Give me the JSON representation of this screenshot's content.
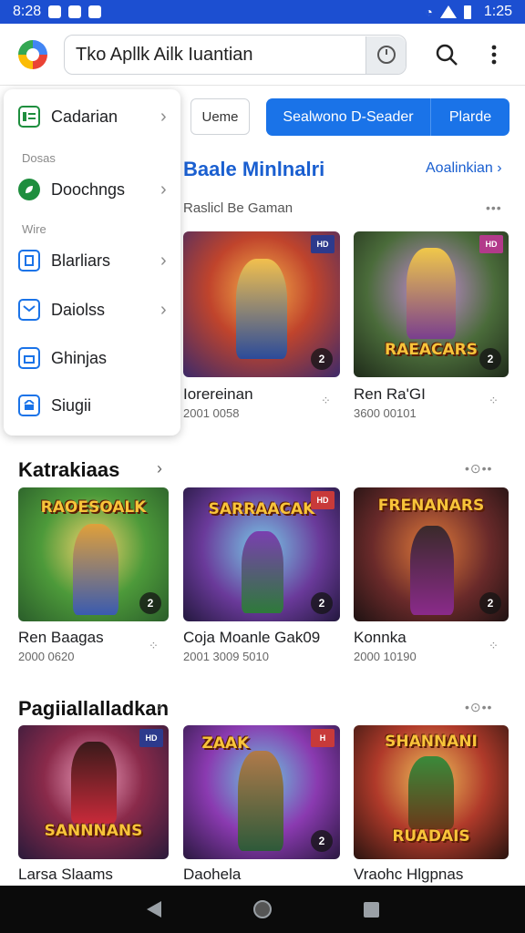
{
  "status_bar": {
    "time": "8:28",
    "clock": "1:25"
  },
  "search": {
    "query": "Tko Apllk Ailk Iuantian"
  },
  "dropdown": {
    "items": [
      {
        "label": "Cadarian",
        "icon": "list-icon",
        "color": "#1e8e3e"
      },
      {
        "label": "Doochngs",
        "icon": "leaf-icon",
        "color": "#1e8e3e"
      },
      {
        "label": "Blarliars",
        "icon": "phone-icon",
        "color": "#1a73e8"
      },
      {
        "label": "Daiolss",
        "icon": "mail-icon",
        "color": "#1a73e8"
      },
      {
        "label": "Ghinjas",
        "icon": "bag-icon",
        "color": "#1a73e8"
      },
      {
        "label": "Siugii",
        "icon": "store-icon",
        "color": "#1a73e8"
      }
    ],
    "headings": [
      "Dosas",
      "Wire"
    ]
  },
  "chips": {
    "home": "Ueme",
    "primary": "Sealwono D-Seader",
    "secondary": "Plarde"
  },
  "section1": {
    "title": "Baale Minlnalri",
    "link": "Aoalinkian",
    "subtitle": "Raslicl Be Gaman",
    "cards": [
      {
        "title": "Iorereinan",
        "meta": "2001 0058",
        "banner": "",
        "flag": "HD",
        "badge": "2"
      },
      {
        "title": "Ren Ra'GI",
        "meta": "3600 00101",
        "banner": "RAEACARS",
        "flag": "HD",
        "badge": "2"
      }
    ]
  },
  "section2": {
    "title": "Katrakiaas",
    "cards": [
      {
        "title": "Ren Baagas",
        "meta": "2000 0620",
        "banner": "RAOESOALK",
        "flag": "",
        "badge": "2"
      },
      {
        "title": "Coja Moanle Gak09",
        "meta": "2001 3009 5010",
        "banner": "SARRAACAK",
        "flag": "HD",
        "badge": "2"
      },
      {
        "title": "Konnka",
        "meta": "2000 10190",
        "banner": "FRENANARS",
        "flag": "",
        "badge": "2"
      }
    ]
  },
  "section3": {
    "title": "Pagiiallalladkan",
    "cards": [
      {
        "title": "Larsa Slaams",
        "meta": "",
        "banner": "SANNNANS",
        "flag": "HD",
        "badge": "2"
      },
      {
        "title": "Daohela",
        "meta": "",
        "banner": "ZAAK",
        "flag": "H",
        "badge": "2"
      },
      {
        "title": "Vraohc Hlgpnas",
        "meta": "",
        "banner": "SHANNANI",
        "flag": "",
        "badge": ""
      }
    ]
  },
  "colors": {
    "accent": "#1a73e8",
    "status_bar": "#1c4fd1",
    "nav_bar": "#0b0b0b"
  }
}
